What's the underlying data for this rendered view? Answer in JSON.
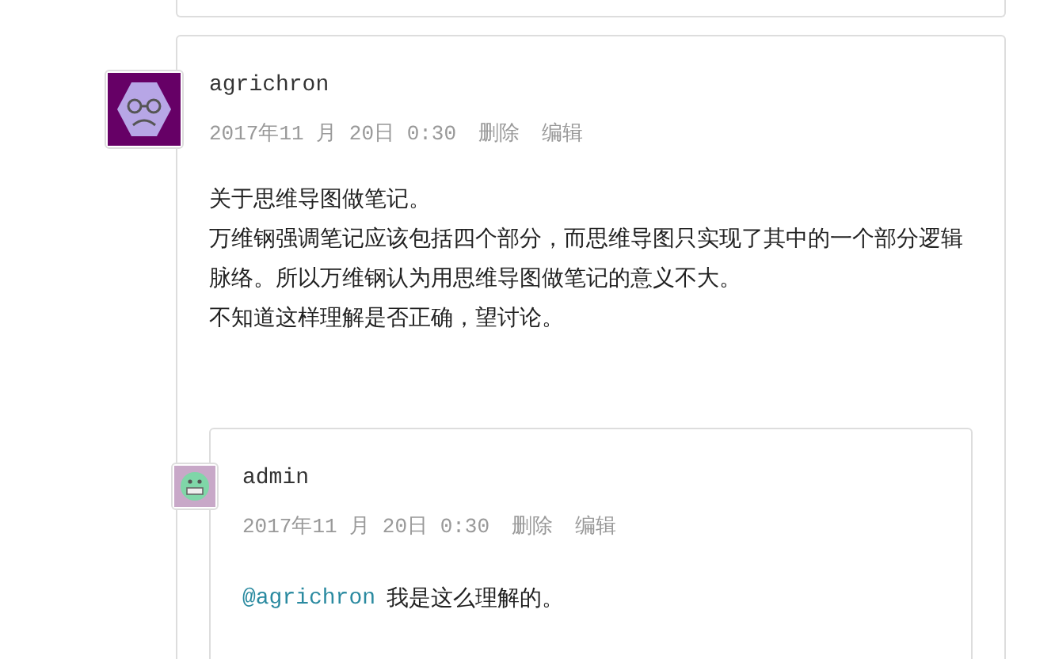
{
  "comment": {
    "author": "agrichron",
    "date": "2017年11 月 20日 0:30",
    "actions": [
      "删除",
      "编辑"
    ],
    "paragraphs": [
      "关于思维导图做笔记。",
      "万维钢强调笔记应该包括四个部分，而思维导图只实现了其中的一个部分逻辑脉络。所以万维钢认为用思维导图做笔记的意义不大。",
      "不知道这样理解是否正确，望讨论。"
    ],
    "reply": {
      "author": "admin",
      "date": "2017年11 月 20日 0:30",
      "actions": [
        "删除",
        "编辑"
      ],
      "mention": "@agrichron",
      "text": "我是这么理解的。"
    }
  }
}
